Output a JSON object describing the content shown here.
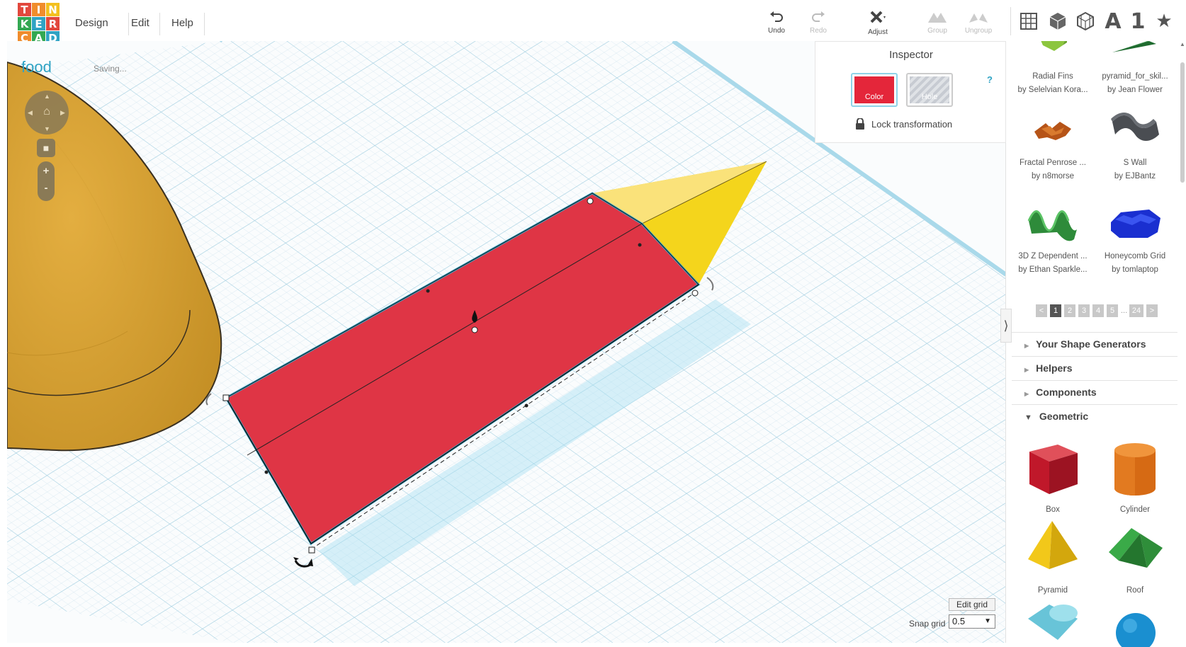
{
  "app": {
    "logo_letters": [
      "T",
      "I",
      "N",
      "K",
      "E",
      "R",
      "C",
      "A",
      "D"
    ],
    "logo_colors": [
      "#e2483d",
      "#f08c2c",
      "#f3c01e",
      "#33a852",
      "#2fa3c4",
      "#e2483d",
      "#f08c2c",
      "#33a852",
      "#2fa3c4"
    ],
    "accent": "#2fa3c4"
  },
  "menu": {
    "design": "Design",
    "edit": "Edit",
    "help": "Help"
  },
  "toolbar": {
    "undo": "Undo",
    "redo": "Redo",
    "adjust": "Adjust",
    "group": "Group",
    "ungroup": "Ungroup"
  },
  "view_icons": [
    "grid-icon",
    "box-shape-icon",
    "wireframe-icon",
    "text-icon",
    "number-icon",
    "star-icon"
  ],
  "view_text": {
    "letter": "A",
    "number": "1",
    "star": "★"
  },
  "project": {
    "name": "food",
    "status": "Saving..."
  },
  "inspector": {
    "title": "Inspector",
    "color_label": "Color",
    "hole_label": "Hole",
    "help": "?",
    "lock_label": "Lock transformation",
    "color": "#e4263a"
  },
  "workplane": {
    "edit_grid": "Edit grid",
    "snap_label": "Snap grid",
    "snap_value": "0.5"
  },
  "panel": {
    "community_shapes": [
      {
        "name": "Radial Fins",
        "author": "by Selelvian Kora..."
      },
      {
        "name": "pyramid_for_skil...",
        "author": "by Jean Flower"
      },
      {
        "name": "Fractal Penrose ...",
        "author": "by n8morse"
      },
      {
        "name": "S Wall",
        "author": "by EJBantz"
      },
      {
        "name": "3D Z Dependent ...",
        "author": "by Ethan Sparkle..."
      },
      {
        "name": "Honeycomb Grid",
        "author": "by tomlaptop"
      }
    ],
    "pager": {
      "prev": "<",
      "pages": [
        "1",
        "2",
        "3",
        "4",
        "5"
      ],
      "dots": "...",
      "last": "24",
      "next": ">"
    },
    "sections": {
      "generators": "Your Shape Generators",
      "helpers": "Helpers",
      "components": "Components",
      "geometric": "Geometric"
    },
    "geometric_shapes": [
      {
        "name": "Box",
        "color": "#d0212e"
      },
      {
        "name": "Cylinder",
        "color": "#e5761c"
      },
      {
        "name": "Pyramid",
        "color": "#f2c81a"
      },
      {
        "name": "Roof",
        "color": "#2f9a3c"
      }
    ]
  }
}
